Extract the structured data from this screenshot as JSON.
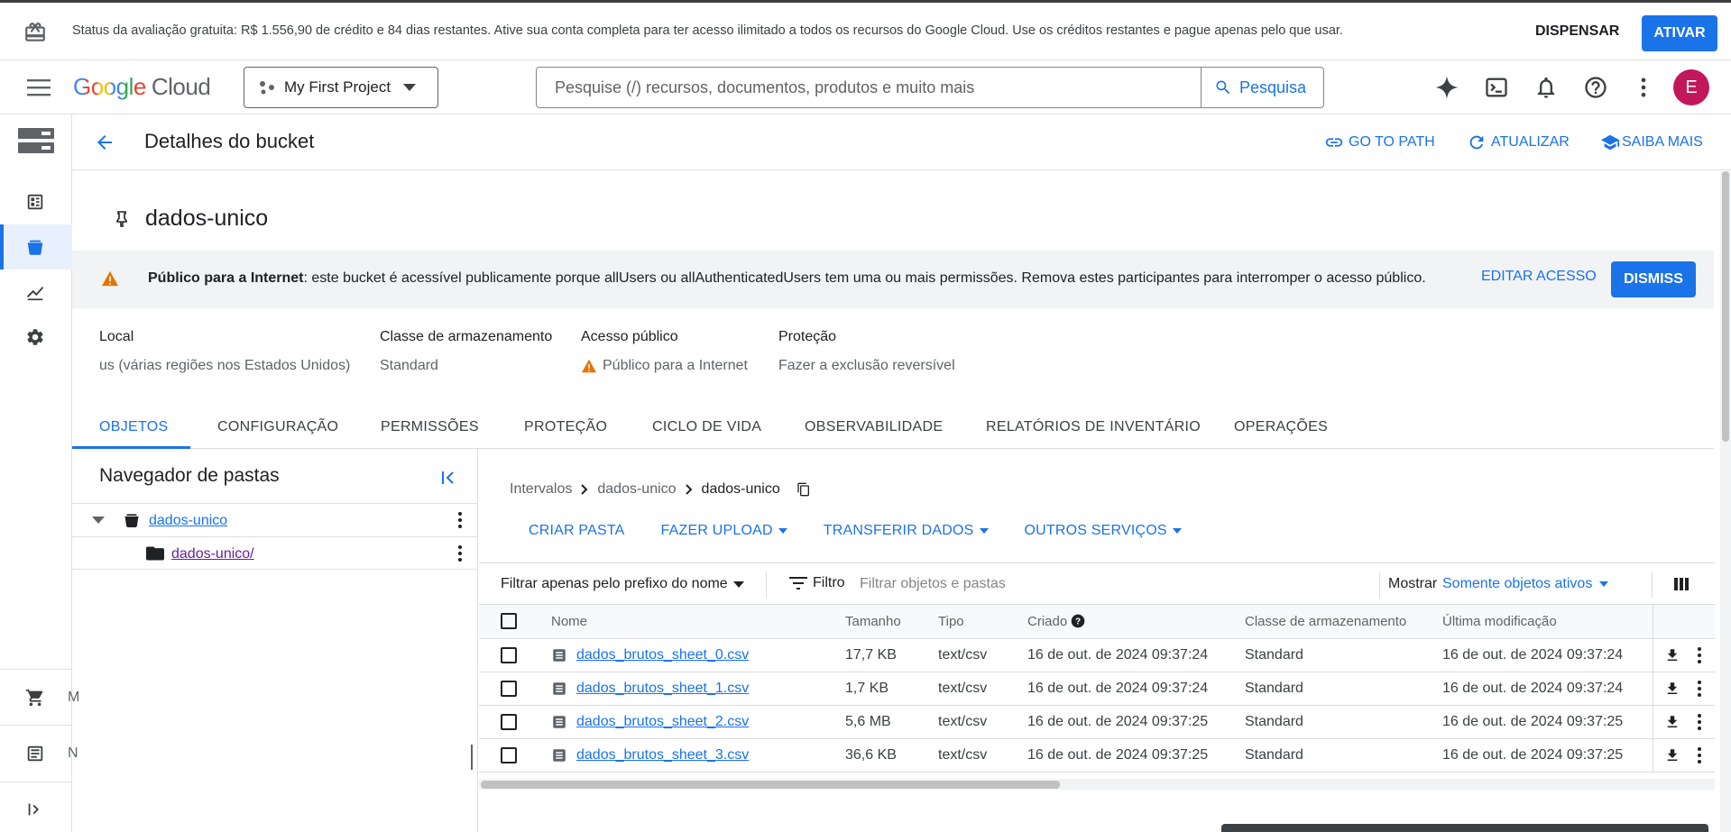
{
  "trial_banner": {
    "message": "Status da avaliação gratuita: R$ 1.556,90 de crédito e 84 dias restantes. Ative sua conta completa para ter acesso ilimitado a todos os recursos do Google Cloud. Use os créditos restantes e pague apenas pelo que usar.",
    "dismiss_label": "DISPENSAR",
    "activate_label": "ATIVAR"
  },
  "header": {
    "logo_google": "Google",
    "logo_cloud": "Cloud",
    "project_name": "My First Project",
    "search_placeholder": "Pesquise (/) recursos, documentos, produtos e muito mais",
    "search_button": "Pesquisa",
    "avatar_letter": "E",
    "icons": [
      "gemini-sparkle-icon",
      "cloud-shell-icon",
      "notifications-icon",
      "help-icon",
      "more-vert-icon"
    ]
  },
  "rail": {
    "items": [
      "storage-logo-icon",
      "dashboard-icon",
      "bucket-icon",
      "monitoring-icon",
      "settings-icon"
    ],
    "bottom_items": [
      {
        "icon": "marketplace-icon",
        "clipped": "M"
      },
      {
        "icon": "release-notes-icon",
        "clipped": "N"
      }
    ],
    "expand_icon": "expand-icon"
  },
  "page": {
    "title": "Detalhes do bucket",
    "actions": {
      "goto": "GO TO PATH",
      "refresh": "ATUALIZAR",
      "learn": "SAIBA MAIS"
    },
    "bucket_name": "dados-unico"
  },
  "warning": {
    "bold": "Público para a Internet",
    "text": ": este bucket é acessível publicamente porque allUsers ou allAuthenticatedUsers tem uma ou mais permissões. Remova estes participantes para interromper o acesso público.",
    "edit_label": "EDITAR ACESSO",
    "dismiss_label": "DISMISS"
  },
  "properties": [
    {
      "label": "Local",
      "value": "us (várias regiões nos Estados Unidos)"
    },
    {
      "label": "Classe de armazenamento",
      "value": "Standard"
    },
    {
      "label": "Acesso público",
      "value": "Público para a Internet"
    },
    {
      "label": "Proteção",
      "value": "Fazer a exclusão reversível"
    }
  ],
  "tabs": [
    "OBJETOS",
    "CONFIGURAÇÃO",
    "PERMISSÕES",
    "PROTEÇÃO",
    "CICLO DE VIDA",
    "OBSERVABILIDADE",
    "RELATÓRIOS DE INVENTÁRIO",
    "OPERAÇÕES"
  ],
  "folder_browser": {
    "title": "Navegador de pastas",
    "root": "dados-unico",
    "child": "dados-unico/"
  },
  "objects": {
    "breadcrumbs": [
      "Intervalos",
      "dados-unico",
      "dados-unico"
    ],
    "toolbar": {
      "create_folder": "CRIAR PASTA",
      "upload": "FAZER UPLOAD",
      "transfer": "TRANSFERIR DADOS",
      "other": "OUTROS SERVIÇOS"
    },
    "filter": {
      "prefix_label": "Filtrar apenas pelo prefixo do nome",
      "filter_label": "Filtro",
      "filter_placeholder": "Filtrar objetos e pastas",
      "show_label": "Mostrar",
      "show_value": "Somente objetos ativos"
    },
    "columns": [
      "Nome",
      "Tamanho",
      "Tipo",
      "Criado",
      "Classe de armazenamento",
      "Última modificação"
    ],
    "rows": [
      {
        "name": "dados_brutos_sheet_0.csv",
        "size": "17,7 KB",
        "type": "text/csv",
        "created": "16 de out. de 2024 09:37:24",
        "class": "Standard",
        "modified": "16 de out. de 2024 09:37:24"
      },
      {
        "name": "dados_brutos_sheet_1.csv",
        "size": "1,7 KB",
        "type": "text/csv",
        "created": "16 de out. de 2024 09:37:24",
        "class": "Standard",
        "modified": "16 de out. de 2024 09:37:24"
      },
      {
        "name": "dados_brutos_sheet_2.csv",
        "size": "5,6 MB",
        "type": "text/csv",
        "created": "16 de out. de 2024 09:37:25",
        "class": "Standard",
        "modified": "16 de out. de 2024 09:37:25"
      },
      {
        "name": "dados_brutos_sheet_3.csv",
        "size": "36,6 KB",
        "type": "text/csv",
        "created": "16 de out. de 2024 09:37:25",
        "class": "Standard",
        "modified": "16 de out. de 2024 09:37:25"
      }
    ]
  },
  "colors": {
    "accent": "#1a73e8",
    "warning": "#e37400",
    "avatar": "#c2185b",
    "visited_link": "#681da8"
  }
}
